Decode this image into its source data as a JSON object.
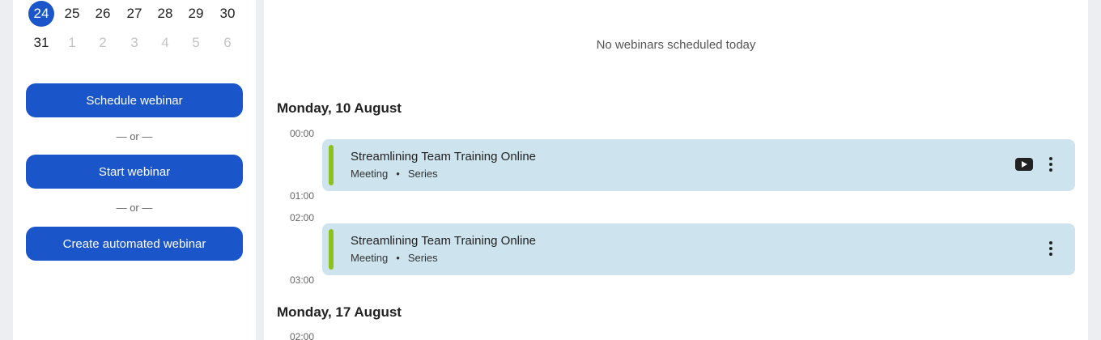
{
  "calendar": {
    "week1": [
      {
        "label": "24",
        "state": "selected"
      },
      {
        "label": "25",
        "state": "normal"
      },
      {
        "label": "26",
        "state": "normal"
      },
      {
        "label": "27",
        "state": "normal"
      },
      {
        "label": "28",
        "state": "normal"
      },
      {
        "label": "29",
        "state": "normal"
      },
      {
        "label": "30",
        "state": "normal"
      }
    ],
    "week2": [
      {
        "label": "31",
        "state": "normal"
      },
      {
        "label": "1",
        "state": "muted"
      },
      {
        "label": "2",
        "state": "muted"
      },
      {
        "label": "3",
        "state": "muted"
      },
      {
        "label": "4",
        "state": "muted"
      },
      {
        "label": "5",
        "state": "muted"
      },
      {
        "label": "6",
        "state": "muted"
      }
    ]
  },
  "actions": {
    "schedule_label": "Schedule webinar",
    "or1": "— or —",
    "start_label": "Start webinar",
    "or2": "— or —",
    "automated_label": "Create automated webinar"
  },
  "main": {
    "empty_message": "No webinars scheduled today",
    "days": [
      {
        "heading": "Monday, 10 August",
        "times": [
          "00:00",
          "01:00",
          "02:00",
          "03:00"
        ],
        "events": [
          {
            "title": "Streamlining Team Training Online",
            "type": "Meeting",
            "dot": "•",
            "recurrence": "Series",
            "icons": [
              "youtube-icon",
              "more-vertical-icon"
            ]
          },
          {
            "title": "Streamlining Team Training Online",
            "type": "Meeting",
            "dot": "•",
            "recurrence": "Series",
            "icons": [
              "more-vertical-icon"
            ]
          }
        ]
      },
      {
        "heading": "Monday, 17 August",
        "times": [
          "02:00"
        ]
      }
    ]
  },
  "colors": {
    "accent": "#1a56c9",
    "event_bg": "#cde3ee",
    "event_bar": "#8bc21b"
  }
}
